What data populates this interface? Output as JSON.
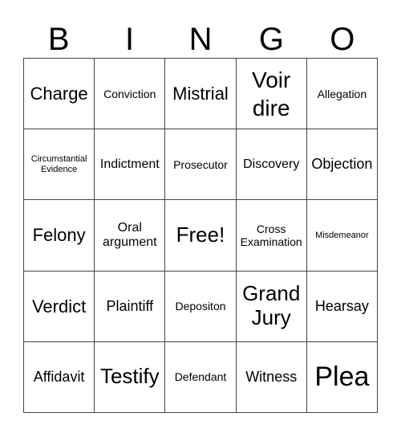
{
  "header": {
    "letters": [
      "B",
      "I",
      "N",
      "G",
      "O"
    ]
  },
  "cells": [
    {
      "text": "Charge",
      "size": "s-xl"
    },
    {
      "text": "Conviction",
      "size": "s-sm"
    },
    {
      "text": "Mistrial",
      "size": "s-xl"
    },
    {
      "text": "Voir dire",
      "size": "s-2l"
    },
    {
      "text": "Allegation",
      "size": "s-sm"
    },
    {
      "text": "Circumstantial Evidence",
      "size": "s-xs"
    },
    {
      "text": "Indictment",
      "size": "s-md"
    },
    {
      "text": "Prosecutor",
      "size": "s-sm"
    },
    {
      "text": "Discovery",
      "size": "s-md"
    },
    {
      "text": "Objection",
      "size": "s-lg"
    },
    {
      "text": "Felony",
      "size": "s-xl"
    },
    {
      "text": "Oral argument",
      "size": "s-md"
    },
    {
      "text": "Free!",
      "size": "s-xxl"
    },
    {
      "text": "Cross Examination",
      "size": "s-sm"
    },
    {
      "text": "Misdemeanor",
      "size": "s-xs"
    },
    {
      "text": "Verdict",
      "size": "s-xl"
    },
    {
      "text": "Plaintiff",
      "size": "s-lg"
    },
    {
      "text": "Depositon",
      "size": "s-sm"
    },
    {
      "text": "Grand Jury",
      "size": "s-xxl"
    },
    {
      "text": "Hearsay",
      "size": "s-lg"
    },
    {
      "text": "Affidavit",
      "size": "s-lg"
    },
    {
      "text": "Testify",
      "size": "s-xxl"
    },
    {
      "text": "Defendant",
      "size": "s-sm"
    },
    {
      "text": "Witness",
      "size": "s-lg"
    },
    {
      "text": "Plea",
      "size": "s-3l"
    }
  ]
}
